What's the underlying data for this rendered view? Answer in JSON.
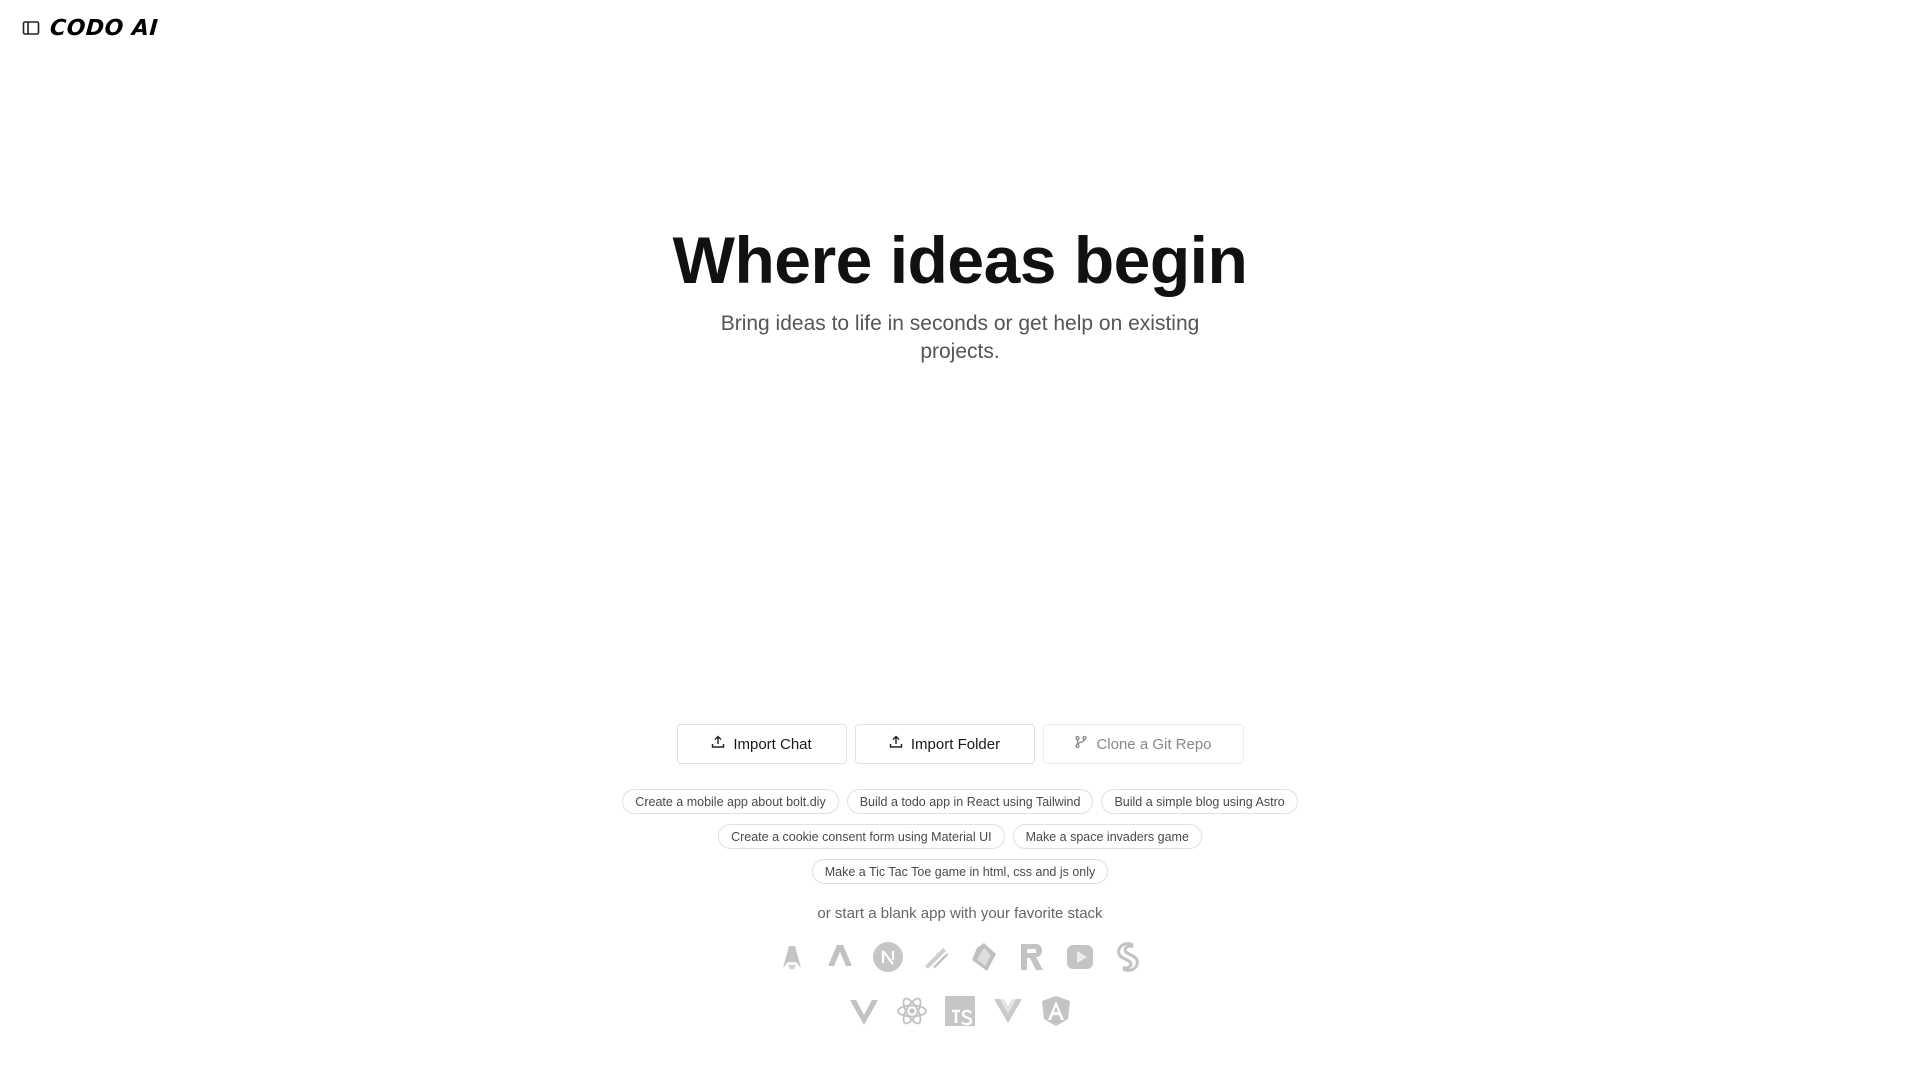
{
  "header": {
    "logo_text": "CODO AI",
    "sidebar_toggle_icon": "sidebar-toggle-icon"
  },
  "hero": {
    "title": "Where ideas begin",
    "subtitle": "Bring ideas to life in seconds or get help on existing projects."
  },
  "actions": {
    "import_chat": "Import Chat",
    "import_folder": "Import Folder",
    "clone_repo": "Clone a Git Repo"
  },
  "suggestions": [
    [
      "Create a mobile app about bolt.diy",
      "Build a todo app in React using Tailwind",
      "Build a simple blog using Astro"
    ],
    [
      "Create a cookie consent form using Material UI",
      "Make a space invaders game"
    ],
    [
      "Make a Tic Tac Toe game in html, css and js only"
    ]
  ],
  "stack": {
    "label": "or start a blank app with your favorite stack",
    "row1": [
      "astro-icon",
      "analog-icon",
      "nextjs-icon",
      "qwik-icon",
      "remix-icon",
      "remotion-icon",
      "slidev-icon",
      "svelte-icon"
    ],
    "row2": [
      "vite-icon",
      "react-icon",
      "typescript-icon",
      "vue-icon",
      "angular-icon"
    ]
  },
  "colors": {
    "icon_gray": "#bdbdbd",
    "text_primary": "#111111",
    "text_muted": "#555555"
  }
}
